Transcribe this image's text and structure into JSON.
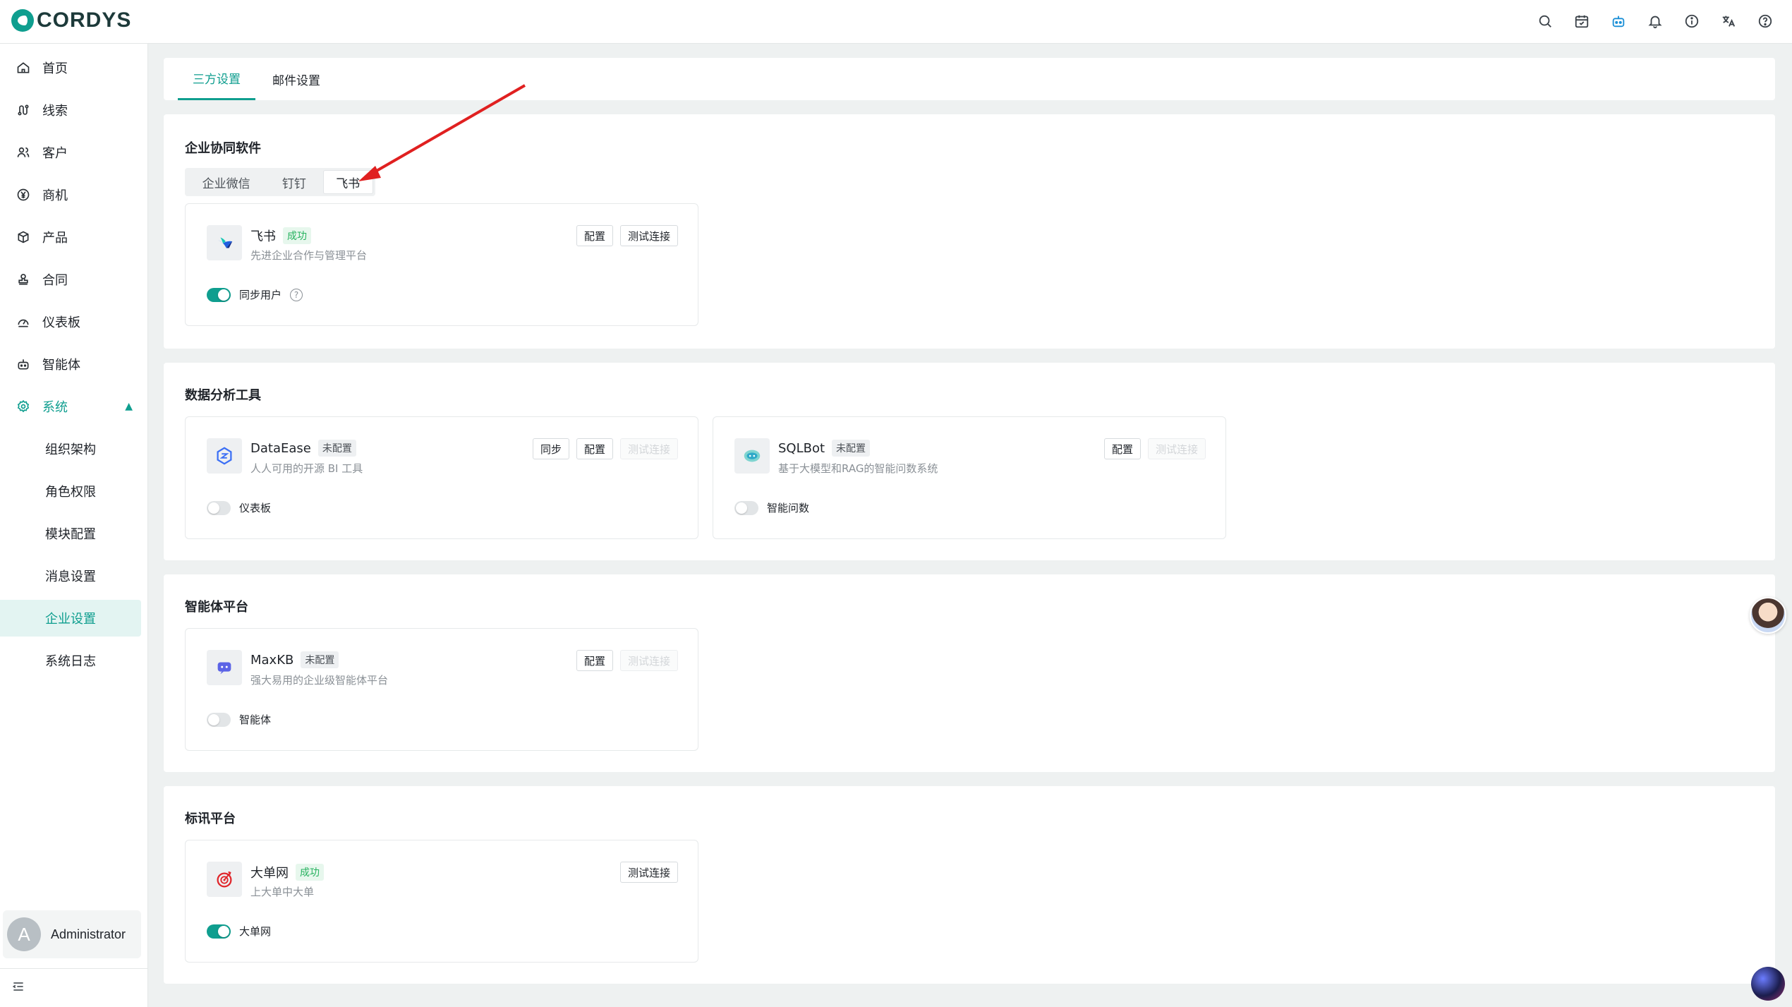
{
  "header": {
    "logo_text": "CORDYS",
    "icons": [
      "search-icon",
      "calendar-icon",
      "robot-icon",
      "bell-icon",
      "info-icon",
      "translate-icon",
      "help-icon"
    ]
  },
  "sidebar": {
    "items": [
      {
        "label": "首页",
        "icon": "home-icon"
      },
      {
        "label": "线索",
        "icon": "route-icon"
      },
      {
        "label": "客户",
        "icon": "user-group-icon"
      },
      {
        "label": "商机",
        "icon": "yen-icon"
      },
      {
        "label": "产品",
        "icon": "box-icon"
      },
      {
        "label": "合同",
        "icon": "stamp-icon"
      },
      {
        "label": "仪表板",
        "icon": "dashboard-icon"
      },
      {
        "label": "智能体",
        "icon": "robot-icon"
      },
      {
        "label": "系统",
        "icon": "gear-icon"
      }
    ],
    "sub_items": [
      "组织架构",
      "角色权限",
      "模块配置",
      "消息设置",
      "企业设置",
      "系统日志"
    ],
    "active_sub": "企业设置",
    "user": {
      "initial": "A",
      "name": "Administrator"
    }
  },
  "tabs": [
    "三方设置",
    "邮件设置"
  ],
  "sections": {
    "collab": {
      "title": "企业协同软件",
      "segments": [
        "企业微信",
        "钉钉",
        "飞书"
      ],
      "active_segment": "飞书",
      "card": {
        "name": "飞书",
        "status": "成功",
        "desc": "先进企业合作与管理平台",
        "buttons": [
          "配置",
          "测试连接"
        ],
        "toggle_label": "同步用户",
        "toggle_on": true
      }
    },
    "analytics": {
      "title": "数据分析工具",
      "cards": [
        {
          "name": "DataEase",
          "status": "未配置",
          "desc": "人人可用的开源 BI 工具",
          "buttons": [
            "同步",
            "配置",
            "测试连接"
          ],
          "toggle_label": "仪表板",
          "toggle_on": false
        },
        {
          "name": "SQLBot",
          "status": "未配置",
          "desc": "基于大模型和RAG的智能问数系统",
          "buttons": [
            "配置",
            "测试连接"
          ],
          "toggle_label": "智能问数",
          "toggle_on": false
        }
      ]
    },
    "agent": {
      "title": "智能体平台",
      "card": {
        "name": "MaxKB",
        "status": "未配置",
        "desc": "强大易用的企业级智能体平台",
        "buttons": [
          "配置",
          "测试连接"
        ],
        "toggle_label": "智能体",
        "toggle_on": false
      }
    },
    "bidding": {
      "title": "标讯平台",
      "card": {
        "name": "大单网",
        "status": "成功",
        "desc": "上大单中大单",
        "buttons": [
          "测试连接"
        ],
        "toggle_label": "大单网",
        "toggle_on": true
      }
    }
  },
  "colors": {
    "accent": "#0f9e8f",
    "success": "#27b25f",
    "arrow": "#e02020"
  }
}
